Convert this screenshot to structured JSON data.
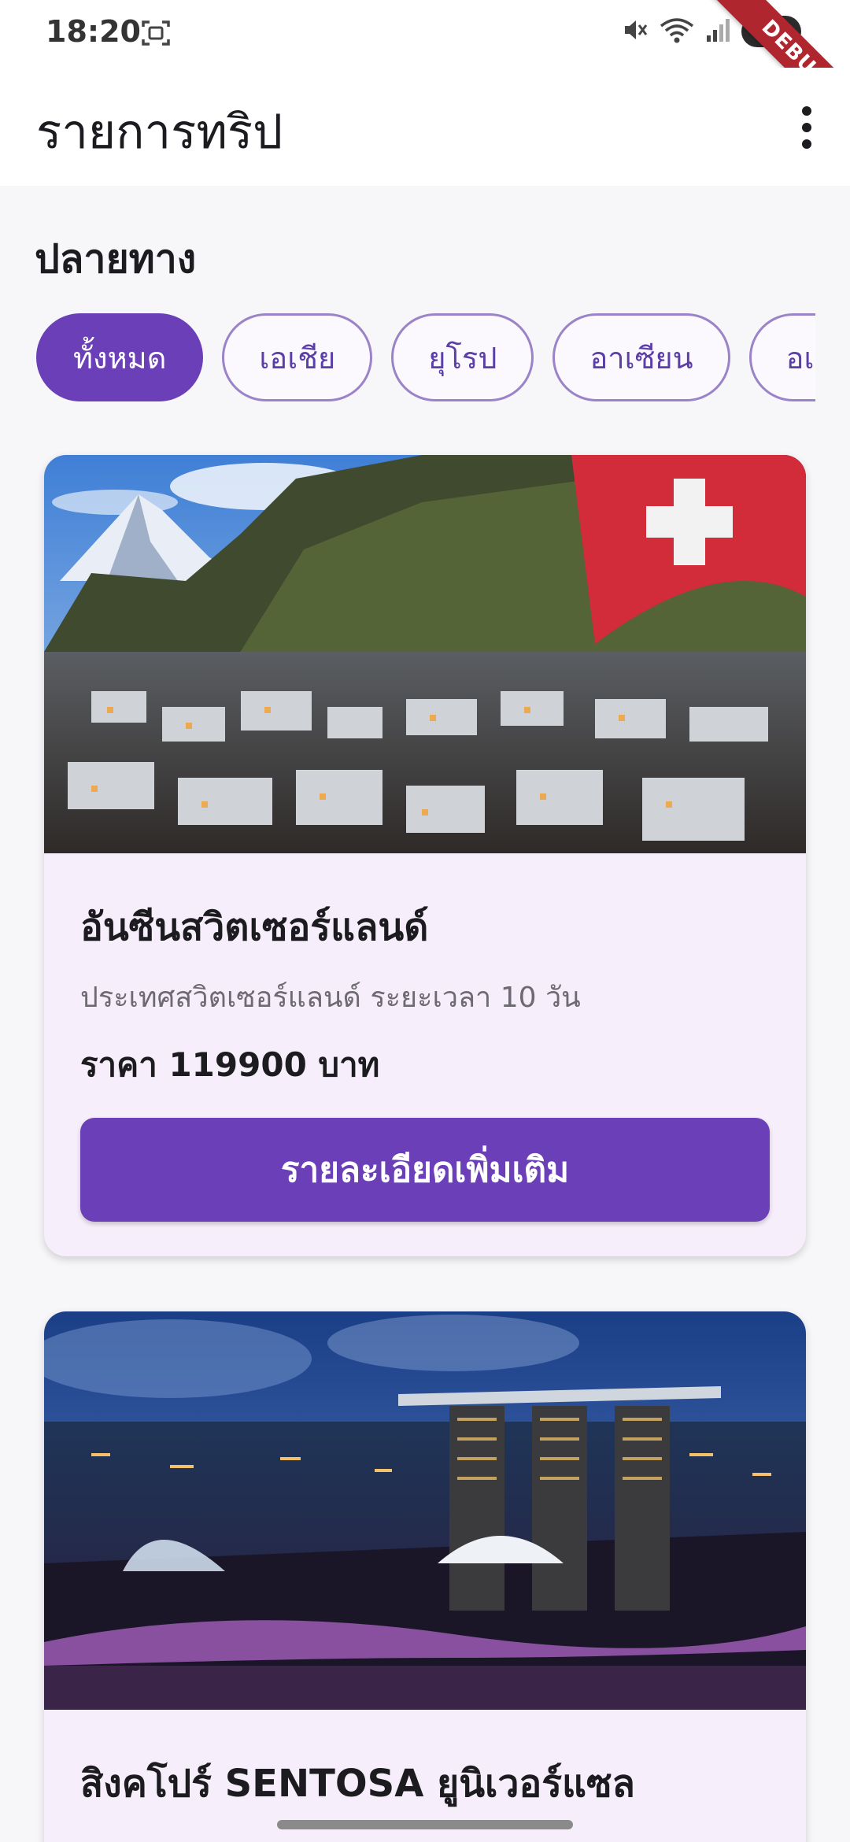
{
  "status_bar": {
    "time": "18:20"
  },
  "debug_ribbon": "DEBUG",
  "app_bar": {
    "title": "รายการทริป"
  },
  "section": {
    "title": "ปลายทาง"
  },
  "filters": [
    {
      "label": "ทั้งหมด",
      "selected": true
    },
    {
      "label": "เอเชีย",
      "selected": false
    },
    {
      "label": "ยุโรป",
      "selected": false
    },
    {
      "label": "อาเซียน",
      "selected": false
    },
    {
      "label": "อเม",
      "selected": false
    }
  ],
  "trips": [
    {
      "title": "อันซีนสวิตเซอร์แลนด์",
      "subtitle": "ประเทศสวิตเซอร์แลนด์  ระยะเวลา 10 วัน",
      "price": "ราคา 119900 บาท",
      "button_label": "รายละเอียดเพิ่มเติม"
    },
    {
      "title": "สิงคโปร์ SENTOSA ยูนิเวอร์แซล"
    }
  ],
  "colors": {
    "primary": "#6a3fb8",
    "card_bg": "#f6eefa",
    "chip_border": "#9b83c8"
  }
}
